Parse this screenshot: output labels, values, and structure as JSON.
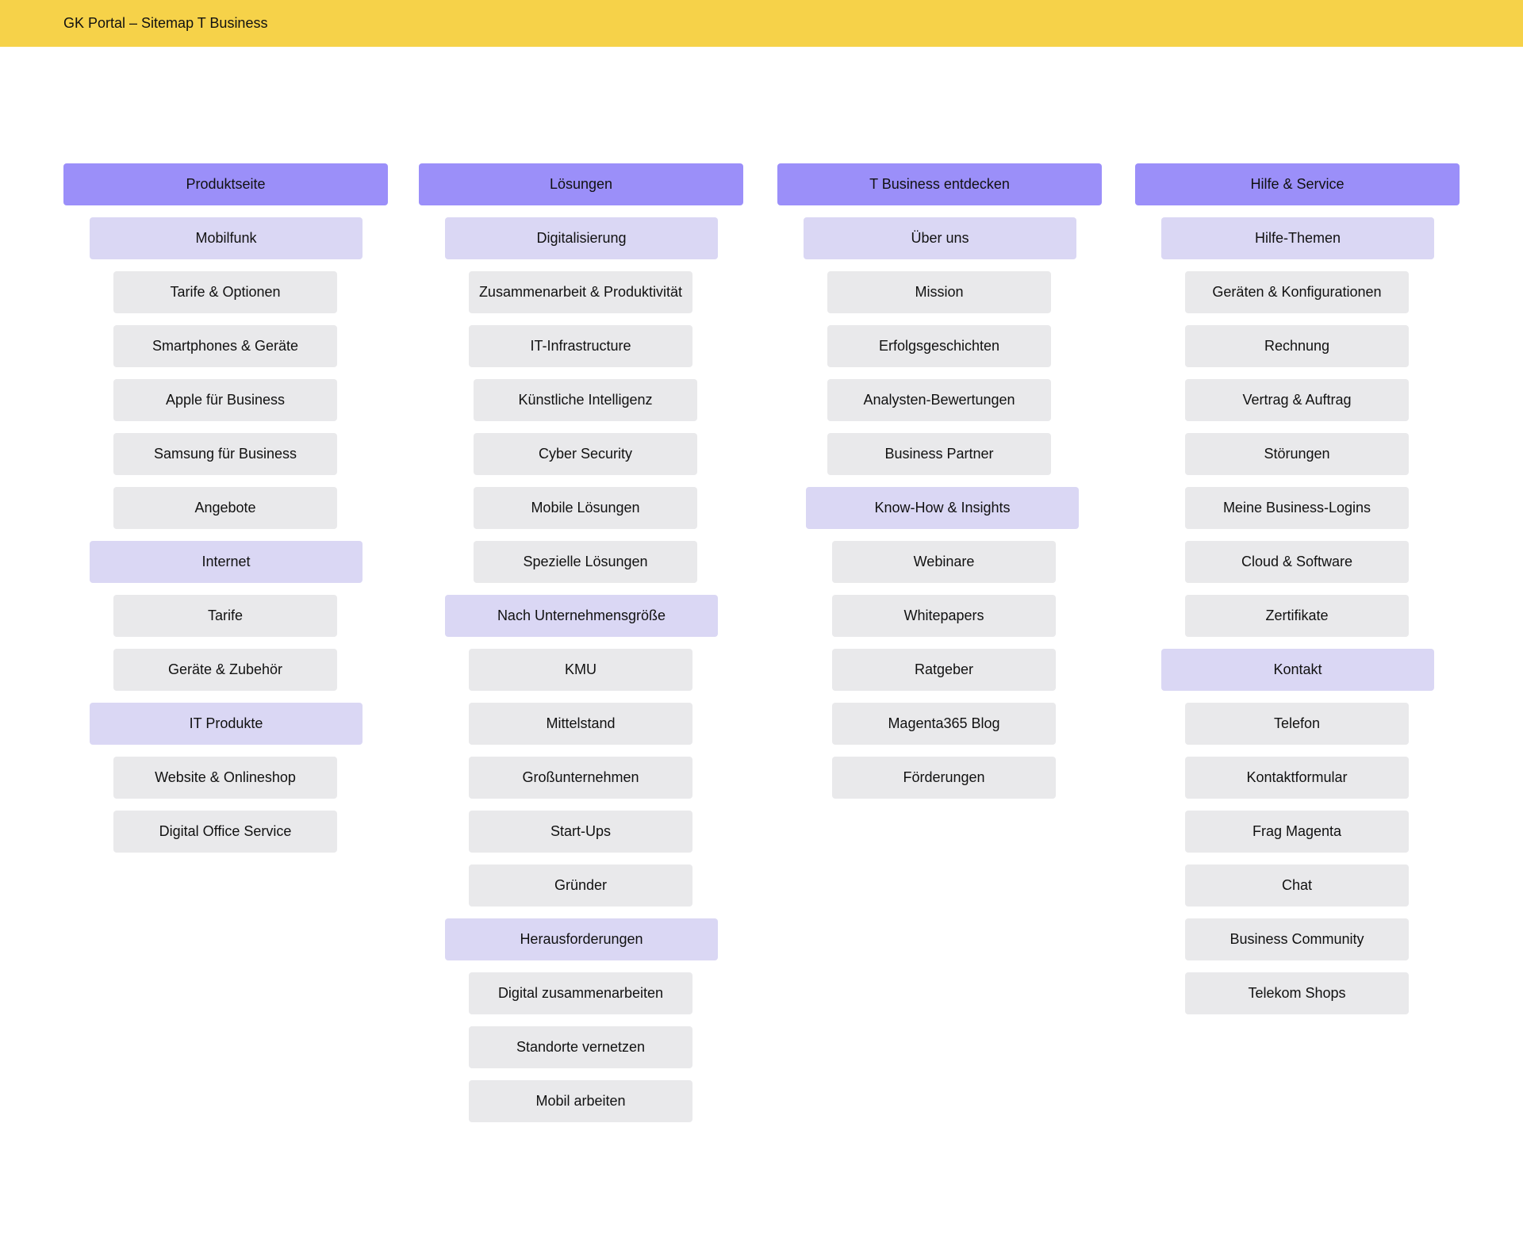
{
  "header": {
    "title": "GK Portal – Sitemap T Business"
  },
  "colors": {
    "header_bar": "#f6d249",
    "level_1": "#9b8ff9",
    "level_2": "#dad7f4",
    "level_3": "#e9e9eb"
  },
  "columns": [
    {
      "title": "Produktseite",
      "groups": [
        {
          "label": "Mobilfunk",
          "items": [
            "Tarife & Optionen",
            "Smartphones & Geräte",
            "Apple für Business",
            "Samsung für Business",
            "Angebote"
          ]
        },
        {
          "label": "Internet",
          "items": [
            "Tarife",
            "Geräte & Zubehör"
          ]
        },
        {
          "label": "IT Produkte",
          "items": [
            "Website & Onlineshop",
            "Digital Office Service"
          ]
        }
      ]
    },
    {
      "title": "Lösungen",
      "groups": [
        {
          "label": "Digitalisierung",
          "items": [
            "Zusammenarbeit & Produktivität",
            "IT-Infrastructure",
            "Künstliche Intelligenz",
            "Cyber Security",
            "Mobile Lösungen",
            "Spezielle Lösungen"
          ]
        },
        {
          "label": "Nach Unternehmensgröße",
          "items": [
            "KMU",
            "Mittelstand",
            "Großunternehmen",
            "Start-Ups",
            "Gründer"
          ]
        },
        {
          "label": "Herausforderungen",
          "items": [
            "Digital zusammenarbeiten",
            "Standorte vernetzen",
            "Mobil arbeiten"
          ]
        }
      ]
    },
    {
      "title": "T Business entdecken",
      "groups": [
        {
          "label": "Über uns",
          "items": [
            "Mission",
            "Erfolgsgeschichten",
            "Analysten-Bewertungen",
            "Business Partner"
          ]
        },
        {
          "label": "Know-How & Insights",
          "items": [
            "Webinare",
            "Whitepapers",
            "Ratgeber",
            "Magenta365 Blog",
            "Förderungen"
          ]
        }
      ]
    },
    {
      "title": "Hilfe & Service",
      "groups": [
        {
          "label": "Hilfe-Themen",
          "items": [
            "Geräten & Konfigurationen",
            "Rechnung",
            "Vertrag & Auftrag",
            "Störungen",
            "Meine Business-Logins",
            "Cloud & Software",
            "Zertifikate"
          ]
        },
        {
          "label": "Kontakt",
          "items": [
            "Telefon",
            "Kontaktformular",
            "Frag Magenta",
            "Chat",
            "Business Community",
            "Telekom Shops"
          ]
        }
      ]
    }
  ]
}
